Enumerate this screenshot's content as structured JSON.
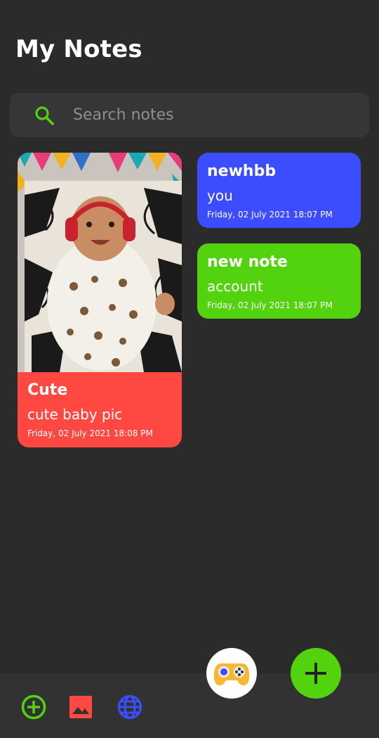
{
  "header": {
    "title": "My Notes"
  },
  "search": {
    "placeholder": "Search notes"
  },
  "notes": [
    {
      "title": "Cute",
      "text": "cute baby pic",
      "date": "Friday, 02 July 2021 18:08 PM",
      "color": "#ff4842",
      "has_image": true
    },
    {
      "title": "newhbb",
      "text": "you",
      "date": "Friday, 02 July 2021 18:07 PM",
      "color": "#3c4cff"
    },
    {
      "title": "new note",
      "text": "account",
      "date": "Friday, 02 July 2021 18:07 PM",
      "color": "#52d30e"
    }
  ],
  "bottom_bar": {
    "icons": [
      "add-circle-icon",
      "image-icon",
      "globe-icon"
    ],
    "colors": {
      "add": "#52d30e",
      "image": "#ff4842",
      "globe": "#3c4cff"
    }
  },
  "fabs": {
    "game": "gamepad-icon",
    "add": "plus-icon"
  }
}
